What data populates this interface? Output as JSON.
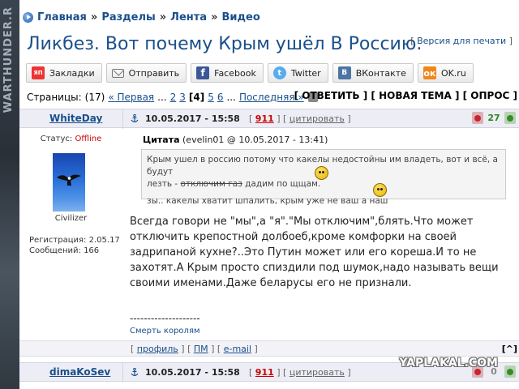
{
  "side_strip": {
    "text": "WARTHUNDER.R"
  },
  "breadcrumb": {
    "items": [
      "Главная",
      "Разделы",
      "Лента",
      "Видео"
    ],
    "separator": "»"
  },
  "topic": {
    "title": "Ликбез. Вот почему Крым ушёл В Россию.",
    "print_prefix": "[",
    "print_link": "Версия для печати",
    "print_suffix": "]"
  },
  "share": [
    {
      "icon": "yandex-bookmarks-icon",
      "glyph": "ЯП",
      "label": "Закладки"
    },
    {
      "icon": "mail-icon",
      "glyph": "",
      "label": "Отправить"
    },
    {
      "icon": "facebook-icon",
      "glyph": "f",
      "label": "Facebook"
    },
    {
      "icon": "twitter-icon",
      "glyph": "t",
      "label": "Twitter"
    },
    {
      "icon": "vkontakte-icon",
      "glyph": "В",
      "label": "ВКонтакте"
    },
    {
      "icon": "odnoklassniki-icon",
      "glyph": "ок",
      "label": "OK.ru"
    }
  ],
  "pagination": {
    "label": "Страницы:",
    "count": "(17)",
    "first": "« Первая",
    "ellipsis": "...",
    "pages_before": [
      "2",
      "3"
    ],
    "current": "[4]",
    "pages_after": [
      "5",
      "6"
    ],
    "ellipsis2": "...",
    "last": "Последняя »"
  },
  "actions": {
    "reply": "[ ОТВЕТИТЬ ]",
    "new_topic": "[ НОВАЯ ТЕМА ]",
    "poll": "[ ОПРОС ]"
  },
  "posts": [
    {
      "author": "WhiteDay",
      "date": "10.05.2017 - 15:58",
      "number": "911",
      "quote_link": "цитировать",
      "rating": "27",
      "user": {
        "status_label": "Статус:",
        "status": "Offline",
        "title": "Civilizer",
        "reg_label": "Регистрация:",
        "reg_date": "2.05.17",
        "msg_label": "Сообщений:",
        "msg_count": "166"
      },
      "quote": {
        "label": "Цитата",
        "meta": "(evelin01 @ 10.05.2017 - 13:41)",
        "line1": "Крым ушел в россию потому что какелы недостойны им владеть, вот и всё, а будут",
        "line2_a": "лезть -",
        "line2_strike": "отключим газ",
        "line2_b": "дадим по щщам.",
        "line3": "зы.. какелы хватит шпалить, крым уже не ваш а наш"
      },
      "text": "Всегда говори не \"мы\",а \"я\".\"Мы отключим\",блять.Что может отключить крепостной долбоеб,кроме комфорки на своей задрипаной кухне?..Это Путин может или его кореша.И то не захотят.А Крым просто спиздили под шумок,надо называть вещи своими именами.Даже беларусы его не признали.",
      "sig_line": "--------------------",
      "signature": "Смерть королям",
      "footer": {
        "profile": "профиль",
        "pm": "ПМ",
        "email": "e-mail",
        "top": "[^]"
      }
    },
    {
      "author": "dimaKoSev",
      "date": "10.05.2017 - 15:58",
      "number": "911",
      "quote_link": "цитировать",
      "rating": "0"
    }
  ],
  "watermark": "YAPLAKAL.COM",
  "colors": {
    "link": "#1a4f8b",
    "offline": "#cc0000",
    "post_number": "#cc0000",
    "rating_positive": "#2a8a1a"
  }
}
